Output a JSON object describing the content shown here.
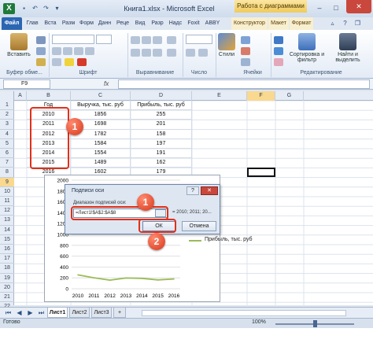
{
  "window": {
    "title": "Книга1.xlsx - Microsoft Excel",
    "context_tab_title": "Работа с диаграммами",
    "app_icon": "X",
    "controls": {
      "minimize": "–",
      "maximize": "□",
      "close": "✕"
    }
  },
  "quick_access": [
    "save-icon",
    "undo-icon",
    "redo-icon",
    "dropdown-icon"
  ],
  "ribbon_tabs": [
    {
      "label": "Файл",
      "active": true
    },
    {
      "label": "Глав"
    },
    {
      "label": "Вста"
    },
    {
      "label": "Разм"
    },
    {
      "label": "Форм"
    },
    {
      "label": "Данн"
    },
    {
      "label": "Реце"
    },
    {
      "label": "Вид"
    },
    {
      "label": "Разр"
    },
    {
      "label": "Надс"
    },
    {
      "label": "Foxit"
    },
    {
      "label": "ABBY"
    },
    {
      "label": "Конструктор",
      "context": true
    },
    {
      "label": "Макет",
      "context": true
    },
    {
      "label": "Формат",
      "context": true
    }
  ],
  "ribbon": {
    "paste_label": "Вставить",
    "styles_label": "Стили",
    "sort_label": "Сортировка и фильтр",
    "find_label": "Найти и выделить",
    "groups": {
      "clipboard": "Буфер обме...",
      "font": "Шрифт",
      "alignment": "Выравнивание",
      "number": "Число",
      "cells": "Ячейки",
      "editing": "Редактирование"
    }
  },
  "formula_bar": {
    "name_box": "F9",
    "fx": "fx",
    "value": ""
  },
  "columns": [
    "A",
    "B",
    "C",
    "D",
    "E",
    "F",
    "G"
  ],
  "selected_column": "F",
  "rows": [
    "1",
    "2",
    "3",
    "4",
    "5",
    "6",
    "7",
    "8",
    "9",
    "10",
    "11",
    "12",
    "13",
    "14",
    "15",
    "16",
    "17",
    "18",
    "19",
    "20",
    "21",
    "22",
    "23",
    "24",
    "25"
  ],
  "table": {
    "headers": [
      "Год",
      "Выручка, тыс. руб",
      "Прибыль, тыс. руб"
    ],
    "data": [
      [
        "2010",
        "1856",
        "255"
      ],
      [
        "2011",
        "1698",
        "201"
      ],
      [
        "2012",
        "1782",
        "158"
      ],
      [
        "2013",
        "1584",
        "197"
      ],
      [
        "2014",
        "1554",
        "191"
      ],
      [
        "2015",
        "1489",
        "162"
      ],
      [
        "2016",
        "1602",
        "179"
      ]
    ]
  },
  "chart_data": {
    "type": "line",
    "x": [
      "2010",
      "2011",
      "2012",
      "2013",
      "2014",
      "2015",
      "2016"
    ],
    "series": [
      {
        "name": "Прибыль, тыс. руб",
        "values": [
          255,
          201,
          158,
          197,
          191,
          162,
          179
        ]
      }
    ],
    "ylim": [
      0,
      2000
    ],
    "y_ticks": [
      "0",
      "200",
      "400",
      "600",
      "800",
      "1000",
      "1200",
      "1400",
      "1600",
      "1800",
      "2000"
    ],
    "legend_visible": [
      "уб",
      "Прибыль, тыс. руб"
    ],
    "series_color": "#9bbb59"
  },
  "dialog": {
    "title": "Подписи оси",
    "help": "?",
    "close": "✕",
    "range_label": "Диапазон подписей оси:",
    "range_value": "=Лист1!$A$2:$A$8",
    "preview": "= 2010; 2011; 20...",
    "ok": "ОК",
    "cancel": "Отмена"
  },
  "callouts": {
    "table": "1",
    "dialog_input": "1",
    "ok_button": "2"
  },
  "sheets": [
    {
      "label": "Лист1",
      "active": true
    },
    {
      "label": "Лист2"
    },
    {
      "label": "Лист3"
    }
  ],
  "status": {
    "ready": "Готово",
    "zoom": "100%"
  }
}
